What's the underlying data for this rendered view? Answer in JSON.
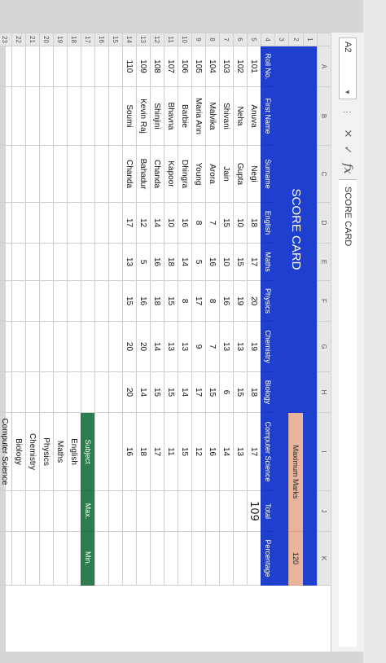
{
  "formula_bar": {
    "name_box": "A2",
    "formula": "SCORE CARD",
    "fx": "fx",
    "cancel": "✕",
    "enter": "✓"
  },
  "columns": [
    "",
    "A",
    "B",
    "C",
    "D",
    "E",
    "F",
    "G",
    "H",
    "I",
    "J",
    "K"
  ],
  "row_numbers": [
    "1",
    "2",
    "3",
    "4",
    "5",
    "6",
    "7",
    "8",
    "9",
    "10",
    "11",
    "12",
    "13",
    "14",
    "15",
    "16",
    "17",
    "18",
    "19",
    "20",
    "21",
    "22",
    "23"
  ],
  "title": "SCORE CARD",
  "max_marks": {
    "label": "Maximum Marks",
    "value": "120"
  },
  "headers": [
    "Roll No.",
    "First Name",
    "Surname",
    "English",
    "Maths",
    "Physics",
    "Chemistry",
    "Biology",
    "Computer Science",
    "Total",
    "Percentage"
  ],
  "students": [
    {
      "roll": "101",
      "first": "Anuva",
      "surname": "Negi",
      "english": "18",
      "maths": "17",
      "physics": "20",
      "chemistry": "19",
      "biology": "18",
      "cs": "17",
      "total": "109"
    },
    {
      "roll": "102",
      "first": "Neha",
      "surname": "Gupta",
      "english": "10",
      "maths": "15",
      "physics": "19",
      "chemistry": "13",
      "biology": "15",
      "cs": "13",
      "total": ""
    },
    {
      "roll": "103",
      "first": "Shivani",
      "surname": "Jain",
      "english": "15",
      "maths": "10",
      "physics": "16",
      "chemistry": "13",
      "biology": "6",
      "cs": "14",
      "total": ""
    },
    {
      "roll": "104",
      "first": "Malvika",
      "surname": "Arora",
      "english": "7",
      "maths": "16",
      "physics": "8",
      "chemistry": "7",
      "biology": "15",
      "cs": "16",
      "total": ""
    },
    {
      "roll": "105",
      "first": "Maria Ann",
      "surname": "Young",
      "english": "8",
      "maths": "5",
      "physics": "17",
      "chemistry": "9",
      "biology": "17",
      "cs": "12",
      "total": ""
    },
    {
      "roll": "106",
      "first": "Barbie",
      "surname": "Dhingra",
      "english": "16",
      "maths": "14",
      "physics": "8",
      "chemistry": "13",
      "biology": "14",
      "cs": "15",
      "total": ""
    },
    {
      "roll": "107",
      "first": "Bhavna",
      "surname": "Kapoor",
      "english": "10",
      "maths": "18",
      "physics": "15",
      "chemistry": "13",
      "biology": "15",
      "cs": "11",
      "total": ""
    },
    {
      "roll": "108",
      "first": "Shinjini",
      "surname": "Chanda",
      "english": "14",
      "maths": "16",
      "physics": "18",
      "chemistry": "14",
      "biology": "15",
      "cs": "17",
      "total": ""
    },
    {
      "roll": "109",
      "first": "Kevin Raj",
      "surname": "Bahadur",
      "english": "12",
      "maths": "5",
      "physics": "16",
      "chemistry": "20",
      "biology": "14",
      "cs": "18",
      "total": ""
    },
    {
      "roll": "110",
      "first": "Soumi",
      "surname": "Chanda",
      "english": "17",
      "maths": "13",
      "physics": "15",
      "chemistry": "20",
      "biology": "20",
      "cs": "16",
      "total": ""
    }
  ],
  "summary": {
    "headers": [
      "Subject",
      "Max.",
      "Min."
    ],
    "subjects": [
      "English",
      "Maths",
      "Physics",
      "Chemistry",
      "Biology",
      "Computer Science"
    ]
  },
  "colors": {
    "title_blue": "#1f3fcf",
    "max_marks_peach": "#e8b49a",
    "summary_green": "#2e7d4e"
  }
}
